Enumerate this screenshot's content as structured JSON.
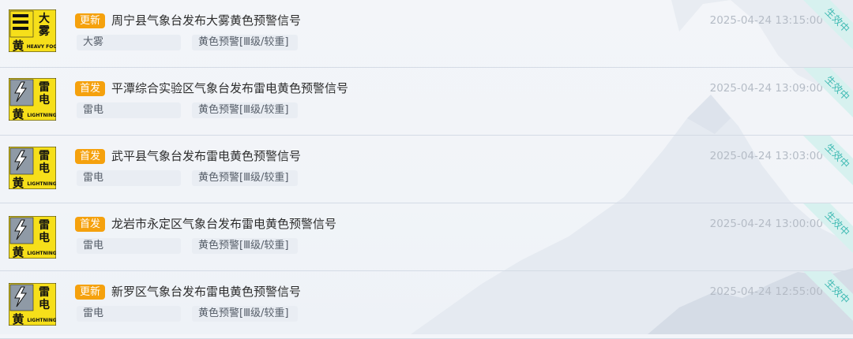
{
  "colors": {
    "tag_bg": "#f5a10d",
    "yellow": "#f6df1a",
    "badge_bg": "#d7f1ef",
    "badge_text": "#3fbab3",
    "time": "#b5bcc6"
  },
  "alerts": [
    {
      "tag": "更新",
      "title": "周宁县气象台发布大雾黄色预警信号",
      "time": "2025-04-24 13:15:00",
      "hazard": "大雾",
      "level": "黄色预警[Ⅲ级/较重]",
      "status": "生效中",
      "icon_name": "heavy-fog-yellow-icon",
      "icon_top": "大",
      "icon_bottom": "雾",
      "icon_level": "黄",
      "icon_en": "HEAVY FOG"
    },
    {
      "tag": "首发",
      "title": "平潭综合实验区气象台发布雷电黄色预警信号",
      "time": "2025-04-24 13:09:00",
      "hazard": "雷电",
      "level": "黄色预警[Ⅲ级/较重]",
      "status": "生效中",
      "icon_name": "lightning-yellow-icon",
      "icon_top": "雷",
      "icon_bottom": "电",
      "icon_level": "黄",
      "icon_en": "LIGHTNING"
    },
    {
      "tag": "首发",
      "title": "武平县气象台发布雷电黄色预警信号",
      "time": "2025-04-24 13:03:00",
      "hazard": "雷电",
      "level": "黄色预警[Ⅲ级/较重]",
      "status": "生效中",
      "icon_name": "lightning-yellow-icon",
      "icon_top": "雷",
      "icon_bottom": "电",
      "icon_level": "黄",
      "icon_en": "LIGHTNING"
    },
    {
      "tag": "首发",
      "title": "龙岩市永定区气象台发布雷电黄色预警信号",
      "time": "2025-04-24 13:00:00",
      "hazard": "雷电",
      "level": "黄色预警[Ⅲ级/较重]",
      "status": "生效中",
      "icon_name": "lightning-yellow-icon",
      "icon_top": "雷",
      "icon_bottom": "电",
      "icon_level": "黄",
      "icon_en": "LIGHTNING"
    },
    {
      "tag": "更新",
      "title": "新罗区气象台发布雷电黄色预警信号",
      "time": "2025-04-24 12:55:00",
      "hazard": "雷电",
      "level": "黄色预警[Ⅲ级/较重]",
      "status": "生效中",
      "icon_name": "lightning-yellow-icon",
      "icon_top": "雷",
      "icon_bottom": "电",
      "icon_level": "黄",
      "icon_en": "LIGHTNING"
    }
  ]
}
